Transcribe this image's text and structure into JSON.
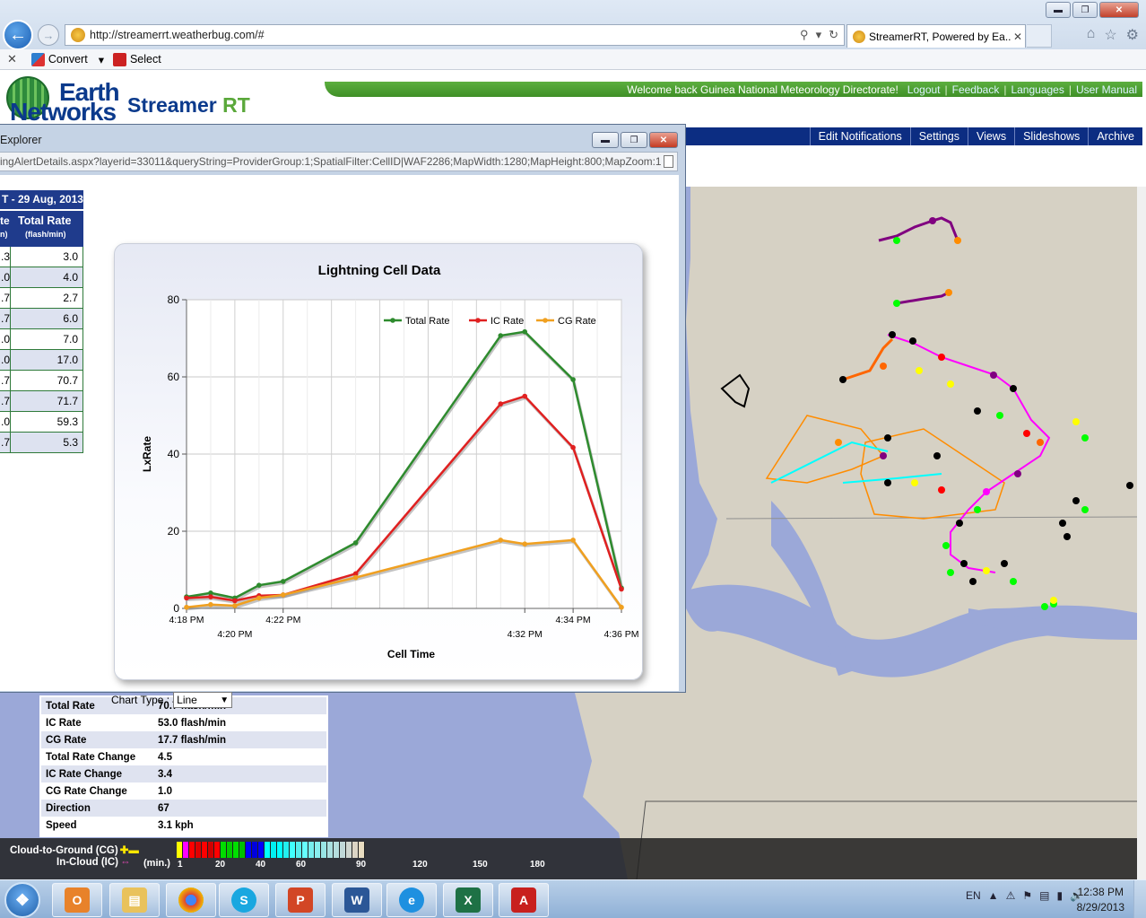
{
  "browser": {
    "url": "http://streamerrt.weatherbug.com/#",
    "tab_title": "StreamerRT, Powered by Ea...",
    "command_bar": {
      "convert": "Convert",
      "select": "Select"
    }
  },
  "header": {
    "logo_line1": "Earth",
    "logo_line2": "Networks",
    "product_name": "Streamer",
    "product_suffix": "RT",
    "welcome": "Welcome back  Guinea National Meteorology Directorate!",
    "links": [
      "Logout",
      "Feedback",
      "Languages",
      "User Manual"
    ],
    "nav": [
      "Edit Notifications",
      "Settings",
      "Views",
      "Slideshows",
      "Archive"
    ]
  },
  "popup": {
    "title": "Explorer",
    "url": "ingAlertDetails.aspx?layerid=33011&queryString=ProviderGroup:1;SpatialFilter:CellID|WAF2286;MapWidth:1280;MapHeight:800;MapZoom:1",
    "history_title": "T - 29 Aug, 2013",
    "col1_label": "te",
    "col1_unit": "n)",
    "col2_label": "Total Rate",
    "col2_unit": "(flash/min)",
    "rows": [
      {
        "a": ".3",
        "b": "3.0"
      },
      {
        "a": ".0",
        "b": "4.0"
      },
      {
        "a": ".7",
        "b": "2.7"
      },
      {
        "a": ".7",
        "b": "6.0"
      },
      {
        "a": ".0",
        "b": "7.0"
      },
      {
        "a": ".0",
        "b": "17.0"
      },
      {
        "a": ".7",
        "b": "70.7"
      },
      {
        "a": ".7",
        "b": "71.7"
      },
      {
        "a": ".0",
        "b": "59.3"
      },
      {
        "a": ".7",
        "b": "5.3"
      }
    ],
    "chart_type_label": "Chart Type :",
    "chart_type_value": "Line"
  },
  "chart_data": {
    "type": "line",
    "title": "Lightning Cell Data",
    "xlabel": "Cell Time",
    "ylabel": "LxRate",
    "ylim": [
      0,
      80
    ],
    "yticks": [
      0,
      20,
      40,
      60,
      80
    ],
    "xlim": [
      0,
      18
    ],
    "xticks": [
      {
        "value": 0,
        "label": "4:18 PM",
        "row": 0
      },
      {
        "value": 2,
        "label": "4:20 PM",
        "row": 1
      },
      {
        "value": 4,
        "label": "4:22 PM",
        "row": 0
      },
      {
        "value": 14,
        "label": "4:32 PM",
        "row": 1
      },
      {
        "value": 16,
        "label": "4:34 PM",
        "row": 0
      },
      {
        "value": 18,
        "label": "4:36 PM",
        "row": 1
      }
    ],
    "x": [
      0,
      1,
      2,
      3,
      4,
      7,
      13,
      14,
      16,
      18
    ],
    "series": [
      {
        "name": "Total Rate",
        "color": "#2e8b2e",
        "values": [
          3.0,
          4.0,
          2.7,
          6.0,
          7.0,
          17.0,
          70.7,
          71.7,
          59.3,
          5.3
        ]
      },
      {
        "name": "IC Rate",
        "color": "#e02020",
        "values": [
          2.7,
          3.0,
          2.0,
          3.3,
          3.5,
          9.0,
          53.0,
          55.0,
          41.7,
          5.0
        ]
      },
      {
        "name": "CG Rate",
        "color": "#f0a020",
        "values": [
          0.3,
          1.0,
          0.7,
          2.7,
          3.5,
          8.0,
          17.7,
          16.7,
          17.7,
          0.3
        ]
      }
    ],
    "legend_position": "top-right",
    "grid": true
  },
  "stats": [
    {
      "label": "Total Rate",
      "value": "70.7  flash/min"
    },
    {
      "label": "IC Rate",
      "value": "53.0  flash/min"
    },
    {
      "label": "CG Rate",
      "value": "17.7  flash/min"
    },
    {
      "label": "Total Rate Change",
      "value": "4.5"
    },
    {
      "label": "IC Rate Change",
      "value": "3.4"
    },
    {
      "label": "CG Rate Change",
      "value": "1.0"
    },
    {
      "label": "Direction",
      "value": "67"
    },
    {
      "label": "Speed",
      "value": "3.1 kph"
    }
  ],
  "legend": {
    "cg_label": "Cloud-to-Ground (CG)",
    "ic_label": "In-Cloud (IC)",
    "min_label": "(min.)",
    "scale_labels": [
      "1",
      "20",
      "40",
      "60",
      "90",
      "120",
      "150",
      "180"
    ],
    "scale_colors": [
      "#ffff00",
      "#ff00ff",
      "#ff0000",
      "#e00000",
      "#ff0000",
      "#d00000",
      "#ff0000",
      "#00dd00",
      "#00cc00",
      "#00e000",
      "#00c000",
      "#0000ff",
      "#0000dd",
      "#0000ff",
      "#00ffff",
      "#00f0f0",
      "#00ffff",
      "#22f0f0",
      "#40ffff",
      "#55eeee",
      "#66ffff",
      "#77eeee",
      "#88eeee",
      "#99e5e5",
      "#aae0e0",
      "#b5dede",
      "#c0d8d8",
      "#cfd6d0",
      "#dcd5c5",
      "#e8dcc0"
    ]
  },
  "taskbar": {
    "apps": [
      "Outlook",
      "Explorer",
      "Chrome",
      "Skype",
      "PowerPoint",
      "Word",
      "Internet Explorer",
      "Excel",
      "Acrobat"
    ],
    "language": "EN",
    "time": "12:38 PM",
    "date": "8/29/2013"
  }
}
